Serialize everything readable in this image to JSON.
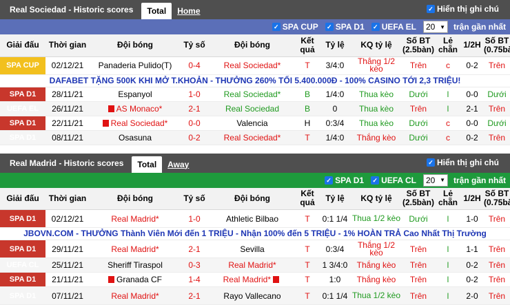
{
  "sec1": {
    "title": "Real Sociedad - Historic scores",
    "tab_total": "Total",
    "tab_link": "Home",
    "show_notes": "Hiển thị ghi chú",
    "filters": [
      "SPA CUP",
      "SPA D1",
      "UEFA EL"
    ],
    "select_value": "20",
    "recent_label": "trận gần nhất",
    "headers": [
      "Giải đấu",
      "Thời gian",
      "Đội bóng",
      "Tỷ số",
      "Đội bóng",
      "Kết quả",
      "Tỷ lệ",
      "KQ tỷ lệ",
      "Số BT (2.5bàn)",
      "Lẻ chẵn",
      "1/2H",
      "Số BT (0.75bàn)"
    ],
    "ad": "DAFABET TẶNG 500K KHI MỞ T.KHOẢN - THƯỞNG 260% TỐI 5.400.000Đ - 100% CASINO TỚI 2,3 TRIỆU!",
    "rows": [
      {
        "league": "SPA CUP",
        "date": "02/12/21",
        "home": "Panaderia Pulido(T)",
        "score": "0-4",
        "away": "Real Sociedad*",
        "result": "T",
        "odds": "3/4:0",
        "odds_result": "Thắng 1/2 kèo",
        "over": "Trên",
        "oddeven": "c",
        "half": "0-2",
        "over075": "Trên"
      },
      {
        "league": "SPA D1",
        "date": "28/11/21",
        "home": "Espanyol",
        "score": "1-0",
        "away": "Real Sociedad*",
        "result": "B",
        "odds": "1/4:0",
        "odds_result": "Thua kèo",
        "over": "Dưới",
        "oddeven": "l",
        "half": "0-0",
        "over075": "Dưới"
      },
      {
        "league": "UEFA EL",
        "date": "26/11/21",
        "home": "AS Monaco*",
        "score": "2-1",
        "away": "Real Sociedad",
        "result": "B",
        "odds": "0",
        "odds_result": "Thua kèo",
        "over": "Trên",
        "oddeven": "l",
        "half": "2-1",
        "over075": "Trên"
      },
      {
        "league": "SPA D1",
        "date": "22/11/21",
        "home": "Real Sociedad*",
        "score": "0-0",
        "away": "Valencia",
        "result": "H",
        "odds": "0:3/4",
        "odds_result": "Thua kèo",
        "over": "Dưới",
        "oddeven": "c",
        "half": "0-0",
        "over075": "Dưới"
      },
      {
        "league": "SPA D1",
        "date": "08/11/21",
        "home": "Osasuna",
        "score": "0-2",
        "away": "Real Sociedad*",
        "result": "T",
        "odds": "1/4:0",
        "odds_result": "Thắng kèo",
        "over": "Dưới",
        "oddeven": "c",
        "half": "0-2",
        "over075": "Trên"
      }
    ]
  },
  "sec2": {
    "title": "Real Madrid - Historic scores",
    "tab_total": "Total",
    "tab_link": "Away",
    "show_notes": "Hiển thị ghi chú",
    "filters": [
      "SPA D1",
      "UEFA CL"
    ],
    "select_value": "20",
    "recent_label": "trận gần nhất",
    "headers": [
      "Giải đấu",
      "Thời gian",
      "Đội bóng",
      "Tỷ số",
      "Đội bóng",
      "Kết quả",
      "Tỷ lệ",
      "KQ tỷ lệ",
      "Số BT (2.5bàn)",
      "Lẻ chẵn",
      "1/2H",
      "Số BT (0.75bàn)"
    ],
    "ad": "JBOVN.COM - THƯỞNG Thành Viên Mới đến 1 TRIỆU - Nhận 100% đến 5 TRIỆU - 1% HOÀN TRẢ Cao Nhất Thị Trường",
    "rows": [
      {
        "league": "SPA D1",
        "date": "02/12/21",
        "home": "Real Madrid*",
        "score": "1-0",
        "away": "Athletic Bilbao",
        "result": "T",
        "odds": "0:1 1/4",
        "odds_result": "Thua 1/2 kèo",
        "over": "Dưới",
        "oddeven": "l",
        "half": "1-0",
        "over075": "Trên"
      },
      {
        "league": "SPA D1",
        "date": "29/11/21",
        "home": "Real Madrid*",
        "score": "2-1",
        "away": "Sevilla",
        "result": "T",
        "odds": "0:3/4",
        "odds_result": "Thắng 1/2 kèo",
        "over": "Trên",
        "oddeven": "l",
        "half": "1-1",
        "over075": "Trên"
      },
      {
        "league": "UEFA CL",
        "date": "25/11/21",
        "home": "Sheriff Tiraspol",
        "score": "0-3",
        "away": "Real Madrid*",
        "result": "T",
        "odds": "1 3/4:0",
        "odds_result": "Thắng kèo",
        "over": "Trên",
        "oddeven": "l",
        "half": "0-2",
        "over075": "Trên"
      },
      {
        "league": "SPA D1",
        "date": "21/11/21",
        "home": "Granada CF",
        "score": "1-4",
        "away": "Real Madrid*",
        "result": "T",
        "odds": "1:0",
        "odds_result": "Thắng kèo",
        "over": "Trên",
        "oddeven": "l",
        "half": "0-2",
        "over075": "Trên"
      },
      {
        "league": "SPA D1",
        "date": "07/11/21",
        "home": "Real Madrid*",
        "score": "2-1",
        "away": "Rayo Vallecano",
        "result": "T",
        "odds": "0:1 1/4",
        "odds_result": "Thua 1/2 kèo",
        "over": "Trên",
        "oddeven": "l",
        "half": "2-0",
        "over075": "Trên"
      }
    ]
  }
}
